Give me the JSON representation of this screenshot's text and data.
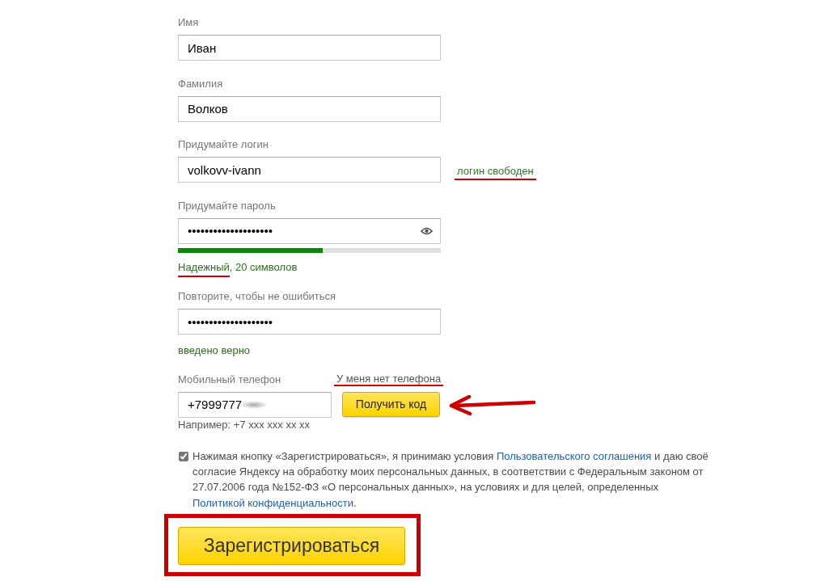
{
  "fields": [
    {
      "kind": "text",
      "label": "Имя",
      "value": "Иван"
    },
    {
      "kind": "text",
      "label": "Фамилия",
      "value": "Волков"
    },
    {
      "kind": "login",
      "label": "Придумайте логин",
      "value": "volkovv-ivann",
      "status": {
        "text": "логин свободен",
        "marked": true
      }
    },
    {
      "kind": "password",
      "label": "Придумайте пароль",
      "value": "••••••••••••••••••••",
      "strength": {
        "level": 0.55,
        "rating": "Надежный",
        "detail": ", 20 символов",
        "marked": true
      }
    },
    {
      "kind": "confirm",
      "label": "Повторите, чтобы не ошибиться",
      "value": "••••••••••••••••••••",
      "hint": "введено верно"
    }
  ],
  "phone": {
    "label": "Мобильный телефон",
    "no_phone_link": {
      "text": "У меня нет телефона",
      "marked": true
    },
    "value": "+7999777",
    "redacted": true,
    "button": {
      "label": "Получить код",
      "marked": true
    },
    "example": "Например: +7 xxx xxx xx xx"
  },
  "consent": {
    "checked": true,
    "parts": [
      {
        "kind": "text",
        "text": "Нажимая кнопку «Зарегистрироваться», я принимаю условия "
      },
      {
        "kind": "link",
        "text": "Пользовательского соглашения"
      },
      {
        "kind": "text",
        "text": " и даю своё согласие Яндексу на обработку моих персональных данных, в соответствии с Федеральным законом от 27.07.2006 года №152-ФЗ «О персональных данных», на условиях и для целей, определенных "
      },
      {
        "kind": "link",
        "text": "Политикой конфиденциальности"
      },
      {
        "kind": "text",
        "text": "."
      }
    ]
  },
  "submit": {
    "label": "Зарегистрироваться",
    "marked": true
  }
}
